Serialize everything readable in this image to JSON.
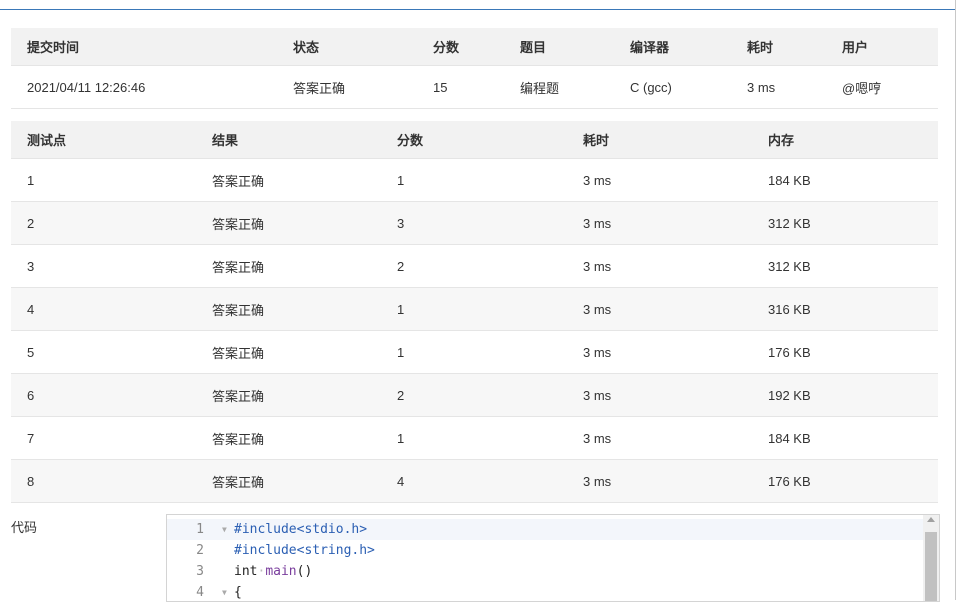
{
  "summary": {
    "headers": [
      "提交时间",
      "状态",
      "分数",
      "题目",
      "编译器",
      "耗时",
      "用户"
    ],
    "row": {
      "time": "2021/04/11 12:26:46",
      "status": "答案正确",
      "score": "15",
      "problem": "编程题",
      "compiler": "C (gcc)",
      "elapsed": "3 ms",
      "user": "@嗯哼"
    }
  },
  "cases": {
    "headers": [
      "测试点",
      "结果",
      "分数",
      "耗时",
      "内存"
    ],
    "rows": [
      {
        "id": "1",
        "result": "答案正确",
        "score": "1",
        "time": "3 ms",
        "memory": "184 KB"
      },
      {
        "id": "2",
        "result": "答案正确",
        "score": "3",
        "time": "3 ms",
        "memory": "312 KB"
      },
      {
        "id": "3",
        "result": "答案正确",
        "score": "2",
        "time": "3 ms",
        "memory": "312 KB"
      },
      {
        "id": "4",
        "result": "答案正确",
        "score": "1",
        "time": "3 ms",
        "memory": "316 KB"
      },
      {
        "id": "5",
        "result": "答案正确",
        "score": "1",
        "time": "3 ms",
        "memory": "176 KB"
      },
      {
        "id": "6",
        "result": "答案正确",
        "score": "2",
        "time": "3 ms",
        "memory": "192 KB"
      },
      {
        "id": "7",
        "result": "答案正确",
        "score": "1",
        "time": "3 ms",
        "memory": "184 KB"
      },
      {
        "id": "8",
        "result": "答案正确",
        "score": "4",
        "time": "3 ms",
        "memory": "176 KB"
      }
    ]
  },
  "code": {
    "label": "代码",
    "lines": [
      {
        "num": "1",
        "parts": [
          {
            "text": "#include<stdio.h>",
            "cls": "kw"
          }
        ]
      },
      {
        "num": "2",
        "parts": [
          {
            "text": "#include<string.h>",
            "cls": "kw"
          }
        ]
      },
      {
        "num": "3",
        "parts": [
          {
            "text": "int",
            "cls": ""
          },
          {
            "text": "·",
            "cls": "dot"
          },
          {
            "text": "main",
            "cls": "fn"
          },
          {
            "text": "()",
            "cls": ""
          }
        ]
      },
      {
        "num": "4",
        "parts": [
          {
            "text": "{",
            "cls": ""
          }
        ]
      }
    ]
  },
  "colors": {
    "status_ok": "#d9534f",
    "header_bg": "#f2f2f2",
    "accent": "#3a78b8"
  }
}
